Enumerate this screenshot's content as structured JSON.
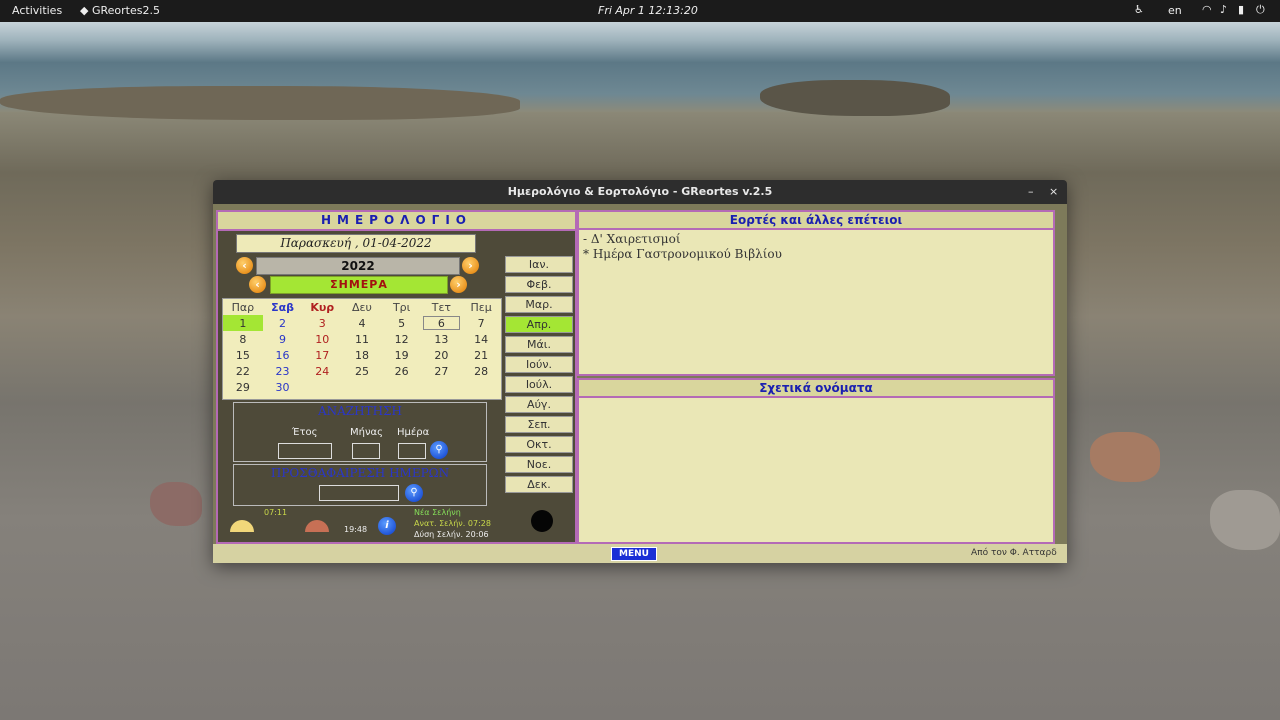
{
  "topbar": {
    "activities": "Activities",
    "app": "GReortes2.5",
    "clock": "Fri Apr 1  12:13:20",
    "lang": "en"
  },
  "window": {
    "title": "Ημερολόγιο & Εορτολόγιο - GReortes v.2.5",
    "min": "–",
    "close": "×"
  },
  "calendar": {
    "header": "ΗΜΕΡΟΛΟΓΙΟ",
    "date_display": "Παρασκευή , 01-04-2022",
    "year": "2022",
    "today": "ΣΗΜΕΡΑ",
    "weekdays": [
      "Παρ",
      "Σαβ",
      "Κυρ",
      "Δευ",
      "Τρι",
      "Τετ",
      "Πεμ"
    ],
    "weeks": [
      [
        "1",
        "2",
        "3",
        "4",
        "5",
        "6",
        "7"
      ],
      [
        "8",
        "9",
        "10",
        "11",
        "12",
        "13",
        "14"
      ],
      [
        "15",
        "16",
        "17",
        "18",
        "19",
        "20",
        "21"
      ],
      [
        "22",
        "23",
        "24",
        "25",
        "26",
        "27",
        "28"
      ],
      [
        "29",
        "30",
        "",
        "",
        "",
        "",
        ""
      ]
    ]
  },
  "months": [
    "Ιαν.",
    "Φεβ.",
    "Μαρ.",
    "Απρ.",
    "Μάι.",
    "Ιούν.",
    "Ιούλ.",
    "Αύγ.",
    "Σεπ.",
    "Οκτ.",
    "Νοε.",
    "Δεκ."
  ],
  "search": {
    "title": "ΑΝΑΖΗΤΗΣΗ",
    "year_label": "Έτος",
    "month_label": "Μήνας",
    "day_label": "Ημέρα"
  },
  "add_days": {
    "title": "ΠΡΟΣΘΑΦΑΙΡΕΣΗ ΗΜΕΡΩΝ"
  },
  "sun": {
    "rise": "07:11",
    "set": "19:48"
  },
  "moon": {
    "phase": "Νέα Σελήνη",
    "rise": "Ανατ. Σελήν. 07:28",
    "set": "Δύση Σελήν. 20:06"
  },
  "feasts": {
    "header": "Εορτές και άλλες επέτειοι",
    "items": [
      "- Δ' Χαιρετισμοί",
      "* Ημέρα Γαστρονομικού Βιβλίου"
    ]
  },
  "names": {
    "header": "Σχετικά ονόματα"
  },
  "footer": {
    "menu": "MENU",
    "author": "Από τον Φ. Ατταρδ"
  }
}
